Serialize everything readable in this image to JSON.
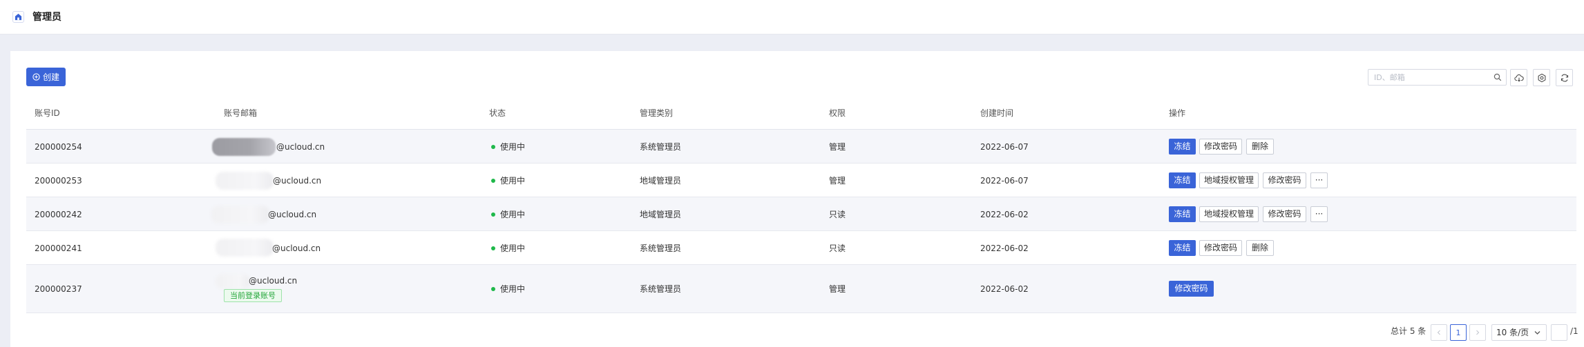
{
  "header": {
    "title": "管理员",
    "icon": "home-icon"
  },
  "toolbar": {
    "create_label": "创建",
    "search_placeholder": "ID、邮箱",
    "icons": [
      "cloud-download-icon",
      "settings-icon",
      "refresh-icon"
    ]
  },
  "table": {
    "columns": [
      "账号ID",
      "账号邮箱",
      "状态",
      "管理类别",
      "权限",
      "创建时间",
      "操作"
    ],
    "rows": [
      {
        "id": "200000254",
        "email": "@ucloud.cn",
        "status": "使用中",
        "type": "系统管理员",
        "permission": "管理",
        "created": "2022-06-07",
        "actions": [
          "冻结",
          "修改密码",
          "删除"
        ]
      },
      {
        "id": "200000253",
        "email": "@ucloud.cn",
        "status": "使用中",
        "type": "地域管理员",
        "permission": "管理",
        "created": "2022-06-07",
        "actions": [
          "冻结",
          "地域授权管理",
          "修改密码",
          "···"
        ]
      },
      {
        "id": "200000242",
        "email": "@ucloud.cn",
        "status": "使用中",
        "type": "地域管理员",
        "permission": "只读",
        "created": "2022-06-02",
        "actions": [
          "冻结",
          "地域授权管理",
          "修改密码",
          "···"
        ]
      },
      {
        "id": "200000241",
        "email": "@ucloud.cn",
        "status": "使用中",
        "type": "系统管理员",
        "permission": "只读",
        "created": "2022-06-02",
        "actions": [
          "冻结",
          "修改密码",
          "删除"
        ]
      },
      {
        "id": "200000237",
        "email": "@ucloud.cn",
        "badge": "当前登录账号",
        "status": "使用中",
        "type": "系统管理员",
        "permission": "管理",
        "created": "2022-06-02",
        "actions": [
          "修改密码"
        ]
      }
    ]
  },
  "pagination": {
    "total_label": "总计 5 条",
    "current_page": "1",
    "page_size_label": "10 条/页",
    "page_total_label": "/1"
  },
  "colors": {
    "primary": "#3a64d8",
    "status_active": "#1fb84a",
    "badge_text": "#24a63a"
  }
}
